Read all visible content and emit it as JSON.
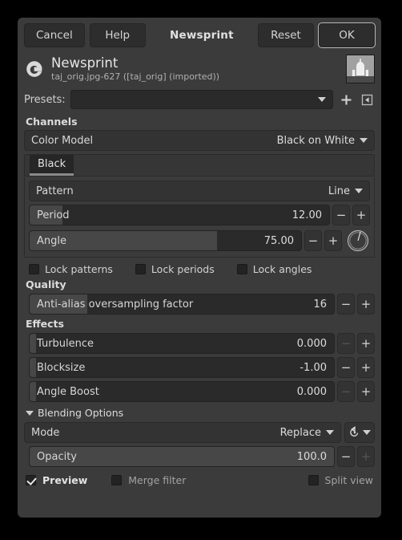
{
  "titlebar": {
    "cancel": "Cancel",
    "help": "Help",
    "title": "Newsprint",
    "reset": "Reset",
    "ok": "OK"
  },
  "header": {
    "title": "Newsprint",
    "subtitle": "taj_orig.jpg-627 ([taj_orig] (imported))",
    "logo": "gimp-logo-icon",
    "thumbnail": "image-thumbnail"
  },
  "presets": {
    "label": "Presets:",
    "value": "",
    "add_icon": "plus-icon",
    "menu_icon": "preset-menu-icon"
  },
  "channels": {
    "section_title": "Channels",
    "color_model": {
      "label": "Color Model",
      "value": "Black on White"
    },
    "tab": "Black",
    "pattern": {
      "label": "Pattern",
      "value": "Line"
    },
    "period": {
      "label": "Period",
      "value": "12.00",
      "fill_pct": 11
    },
    "angle": {
      "label": "Angle",
      "value": "75.00",
      "fill_pct": 69,
      "dial": "angle-dial"
    },
    "locks": [
      {
        "label": "Lock patterns",
        "checked": false
      },
      {
        "label": "Lock periods",
        "checked": false
      },
      {
        "label": "Lock angles",
        "checked": false
      }
    ]
  },
  "quality": {
    "section_title": "Quality",
    "antialias": {
      "label": "Anti-alias oversampling factor",
      "value": "16",
      "fill_pct": 19
    }
  },
  "effects": {
    "section_title": "Effects",
    "rows": [
      {
        "label": "Turbulence",
        "value": "0.000",
        "fill_pct": 2,
        "minus_dim": true,
        "plus_dim": false
      },
      {
        "label": "Blocksize",
        "value": "-1.00",
        "fill_pct": 2,
        "minus_dim": false,
        "plus_dim": false
      },
      {
        "label": "Angle Boost",
        "value": "0.000",
        "fill_pct": 2,
        "minus_dim": true,
        "plus_dim": false
      }
    ]
  },
  "blending": {
    "expander_label": "Blending Options",
    "mode": {
      "label": "Mode",
      "value": "Replace"
    },
    "revert_icon": "revert-icon",
    "opacity": {
      "label": "Opacity",
      "value": "100.0",
      "fill_pct": 100,
      "minus_dim": false,
      "plus_dim": true
    }
  },
  "footer": {
    "preview": {
      "label": "Preview",
      "checked": true
    },
    "merge_filter": {
      "label": "Merge filter",
      "checked": false
    },
    "split_view": {
      "label": "Split view",
      "checked": false
    }
  },
  "symbols": {
    "minus": "−",
    "plus": "+"
  }
}
